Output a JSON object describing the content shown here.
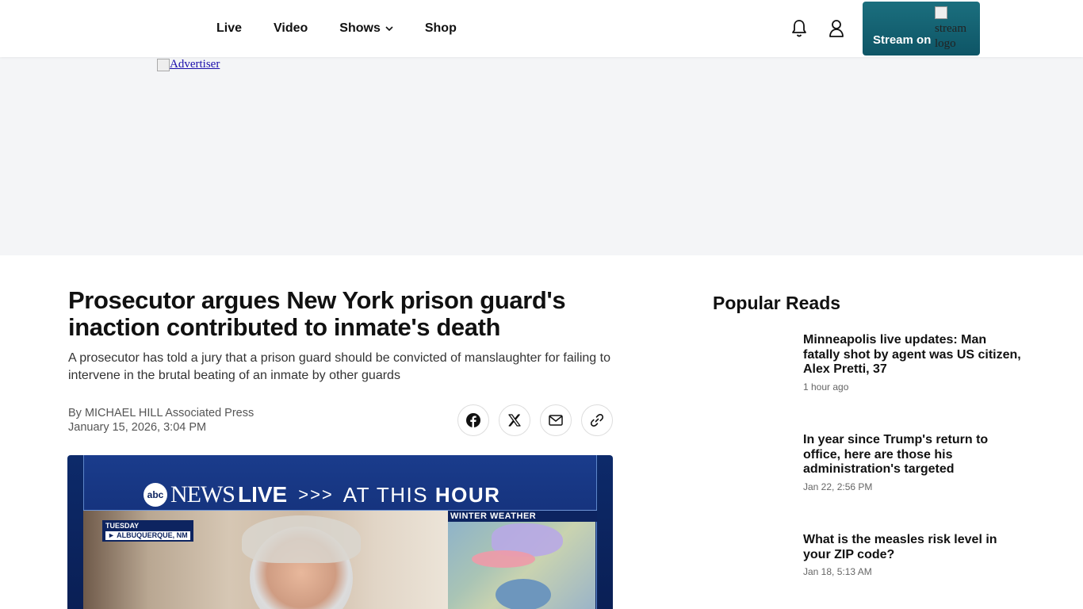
{
  "nav": {
    "items": [
      {
        "label": "Live"
      },
      {
        "label": "Video"
      },
      {
        "label": "Shows"
      },
      {
        "label": "Shop"
      }
    ],
    "stream_label": "Stream on",
    "stream_logo_alt": "stream logo"
  },
  "ad": {
    "alt": "Advertiser"
  },
  "article": {
    "headline": "Prosecutor argues New York prison guard's inaction contributed to inmate's death",
    "dek": "A prosecutor has told a jury that a prison guard should be convicted of manslaughter for failing to intervene in the brutal beating of an inmate by other guards",
    "byline": "By MICHAEL HILL Associated Press",
    "date": "January 15, 2026, 3:04 PM",
    "share": [
      "facebook-icon",
      "x-icon",
      "mail-icon",
      "link-icon"
    ]
  },
  "video": {
    "abc": "abc",
    "news": "NEWS",
    "live": "LIVE",
    "arrows": ">>>",
    "at_this": "AT THIS",
    "hour": "HOUR",
    "day": "TUESDAY",
    "location": "► ALBUQUERQUE, NM",
    "weather": "WINTER WEATHER"
  },
  "sidebar": {
    "title": "Popular Reads",
    "items": [
      {
        "title": "Minneapolis live updates: Man fatally shot by agent was US citizen, Alex Pretti, 37",
        "time": "1 hour ago"
      },
      {
        "title": "In year since Trump's return to office, here are those his administration's targeted",
        "time": "Jan 22, 2:56 PM"
      },
      {
        "title": "What is the measles risk level in your ZIP code?",
        "time": "Jan 18, 5:13 AM"
      }
    ]
  }
}
